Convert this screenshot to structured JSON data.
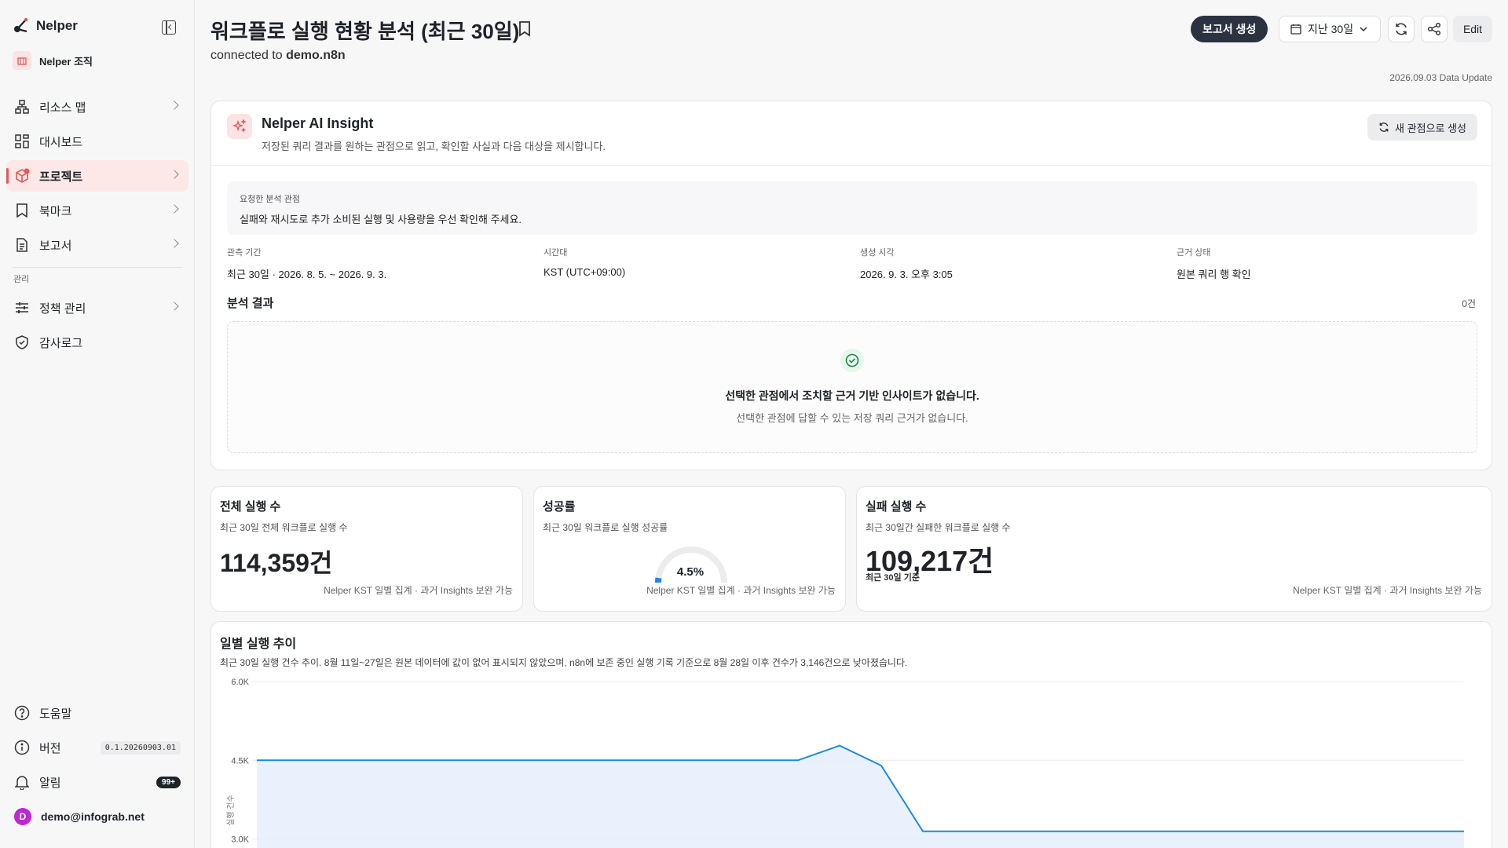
{
  "app": {
    "name": "Nelper",
    "org": "Nelper 조직"
  },
  "sidebar": {
    "items": [
      {
        "label": "리소스 맵",
        "icon": "resource-map-icon"
      },
      {
        "label": "대시보드",
        "icon": "dashboard-icon"
      },
      {
        "label": "프로젝트",
        "icon": "project-icon",
        "active": true
      },
      {
        "label": "북마크",
        "icon": "bookmark-icon"
      },
      {
        "label": "보고서",
        "icon": "report-icon"
      }
    ],
    "section_admin": "관리",
    "admin_items": [
      {
        "label": "정책 관리",
        "icon": "policy-icon"
      },
      {
        "label": "감사로그",
        "icon": "audit-log-icon"
      }
    ],
    "bottom": {
      "help": "도움말",
      "version_label": "버전",
      "version_value": "0.1.20260903.01",
      "alerts_label": "알림",
      "alerts_badge": "99+",
      "user_email": "demo@infograb.net",
      "user_initial": "D"
    }
  },
  "header": {
    "title": "워크플로 실행 현황 분석 (최근 30일)",
    "connected_prefix": "connected to ",
    "connected_target": "demo.n8n",
    "generate_report": "보고서 생성",
    "date_range": "지난 30일",
    "edit": "Edit",
    "data_update": "2026.09.03 Data Update"
  },
  "insight": {
    "title": "Nelper AI Insight",
    "description": "저장된 쿼리 결과를 원하는 관점으로 읽고, 확인할 사실과 다음 대상을 제시합니다.",
    "new_perspective_button": "새 관점으로 생성",
    "request_label": "요청한 분석 관점",
    "request_text": "실패와 재시도로 추가 소비된 실행 및 사용량을 우선 확인해 주세요.",
    "meta": [
      {
        "label": "관측 기간",
        "value": "최근 30일 · 2026. 8. 5. ~ 2026. 9. 3."
      },
      {
        "label": "시간대",
        "value": "KST (UTC+09:00)"
      },
      {
        "label": "생성 시각",
        "value": "2026. 9. 3. 오후 3:05"
      },
      {
        "label": "근거 상태",
        "value": "원본 쿼리 행 확인"
      }
    ],
    "result_title": "분석 결과",
    "result_count": "0건",
    "empty_title": "선택한 관점에서 조치할 근거 기반 인사이트가 없습니다.",
    "empty_desc": "선택한 관점에 답할 수 있는 저장 쿼리 근거가 없습니다."
  },
  "kpis": {
    "total": {
      "title": "전체 실행 수",
      "subtitle": "최근 30일 전체 워크플로 실행 수",
      "value": "114,359건",
      "footer": "Nelper KST 일별 집계 · 과거 Insights 보완 가능"
    },
    "success": {
      "title": "성공률",
      "subtitle": "최근 30일 워크플로 실행 성공률",
      "value": "4.5%",
      "rate": 0.045,
      "footer": "Nelper KST 일별 집계 · 과거 Insights 보완 가능"
    },
    "failed": {
      "title": "실패 실행 수",
      "subtitle": "최근 30일간 실패한 워크플로 실행 수",
      "value": "109,217건",
      "note": "최근 30일 기준",
      "footer": "Nelper KST 일별 집계 · 과거 Insights 보완 가능"
    }
  },
  "trend": {
    "title": "일별 실행 추이",
    "description": "최근 30일 실행 건수 추이. 8월 11일~27일은 원본 데이터에 값이 없어 표시되지 않았으며, n8n에 보존 중인 실행 기록 기준으로 8월 28일 이후 건수가 3,146건으로 낮아졌습니다."
  },
  "chart_data": {
    "type": "area",
    "title": "일별 실행 추이",
    "ylabel": "실행 건수",
    "yticks": [
      "6.0K",
      "4.5K",
      "3.0K"
    ],
    "ylim": [
      2500,
      6000
    ],
    "x": [
      0,
      1,
      2,
      3,
      4,
      5,
      6,
      7,
      8,
      9,
      10,
      11,
      12,
      13,
      14,
      15,
      16,
      17,
      18,
      19,
      20,
      21,
      22,
      23,
      24,
      25,
      26,
      27,
      28,
      29
    ],
    "values": [
      4500,
      4500,
      4500,
      4500,
      4500,
      4500,
      4500,
      4500,
      4500,
      4500,
      4500,
      4500,
      4500,
      4500,
      4780,
      4400,
      3146,
      3146,
      3146,
      3146,
      3146,
      3146,
      3146,
      3146,
      3146,
      3146,
      3146,
      3146,
      3146,
      3146
    ],
    "grid": true,
    "color": "#1e88e5"
  }
}
